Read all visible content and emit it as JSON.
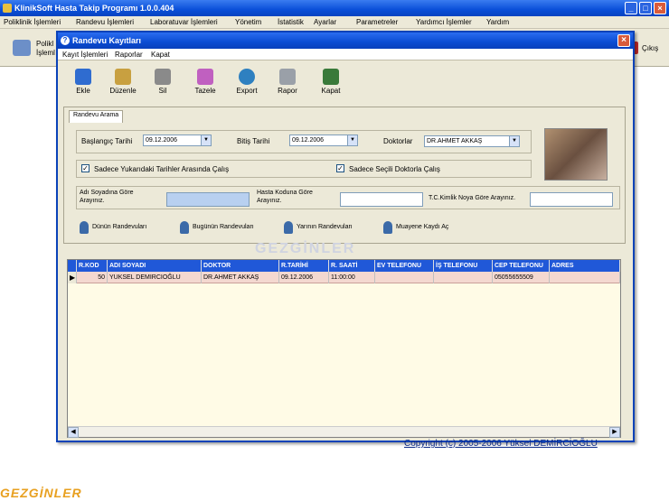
{
  "app": {
    "title": "KlinikSoft Hasta Takip Programı  1.0.0.404",
    "menu": [
      "Poliklinik İşlemleri",
      "Randevu İşlemleri",
      "Laboratuvar İşlemleri",
      "Yönetim",
      "İstatistik",
      "Ayarlar",
      "Parametreler",
      "Yardımcı İşlemler",
      "Yardım"
    ],
    "toolbar_left_label_1": "Polikl",
    "toolbar_left_label_2": "İşleml",
    "exit_label": "Çıkış",
    "copyright": "Copyright (c) 2005-2006 Yüksel DEMİRCİOĞLU"
  },
  "dialog": {
    "title": "Randevu Kayıtları",
    "menu": [
      "Kayıt İşlemleri",
      "Raporlar",
      "Kapat"
    ],
    "toolbar": [
      {
        "label": "Ekle",
        "icon": "add-icon"
      },
      {
        "label": "Düzenle",
        "icon": "edit-icon"
      },
      {
        "label": "Sil",
        "icon": "delete-icon"
      },
      {
        "label": "Tazele",
        "icon": "refresh-icon"
      },
      {
        "label": "Export",
        "icon": "export-icon"
      },
      {
        "label": "Rapor",
        "icon": "printer-icon"
      },
      {
        "label": "Kapat",
        "icon": "exit-icon"
      }
    ],
    "tab": "Randevu Arama",
    "start_label": "Başlangıç Tarihi",
    "start_value": "09.12.2006",
    "end_label": "Bitiş Tarihi",
    "end_value": "09.12.2006",
    "doctors_label": "Doktorlar",
    "doctor_value": "DR.AHMET AKKAŞ",
    "chk_dates": "Sadece Yukarıdaki Tarihler Arasında Çalış",
    "chk_doctor": "Sadece Seçili Doktorla Çalış",
    "search_name_1": "Adı Soyadına Göre",
    "search_name_2": "Arayınız.",
    "search_code_1": "Hasta Koduna Göre",
    "search_code_2": "Arayınız.",
    "search_tc": "T.C.Kimlik Noya Göre Arayınız.",
    "buttons": [
      "Dünün Randevuları",
      "Bugünün Randevuları",
      "Yarının Randevuları",
      "Muayene Kaydı Aç"
    ],
    "grid": {
      "columns": [
        "R.KOD",
        "ADI SOYADI",
        "DOKTOR",
        "R.TARİHİ",
        "R. SAATİ",
        "EV TELEFONU",
        "İŞ TELEFONU",
        "CEP TELEFONU",
        "ADRES"
      ],
      "row": [
        "50",
        "YUKSEL DEMIRCIOĞLU",
        "DR.AHMET AKKAŞ",
        "09.12.2006",
        "11:00:00",
        "",
        "",
        "05055655509",
        ""
      ]
    }
  },
  "watermark": "GEZGİNLER"
}
